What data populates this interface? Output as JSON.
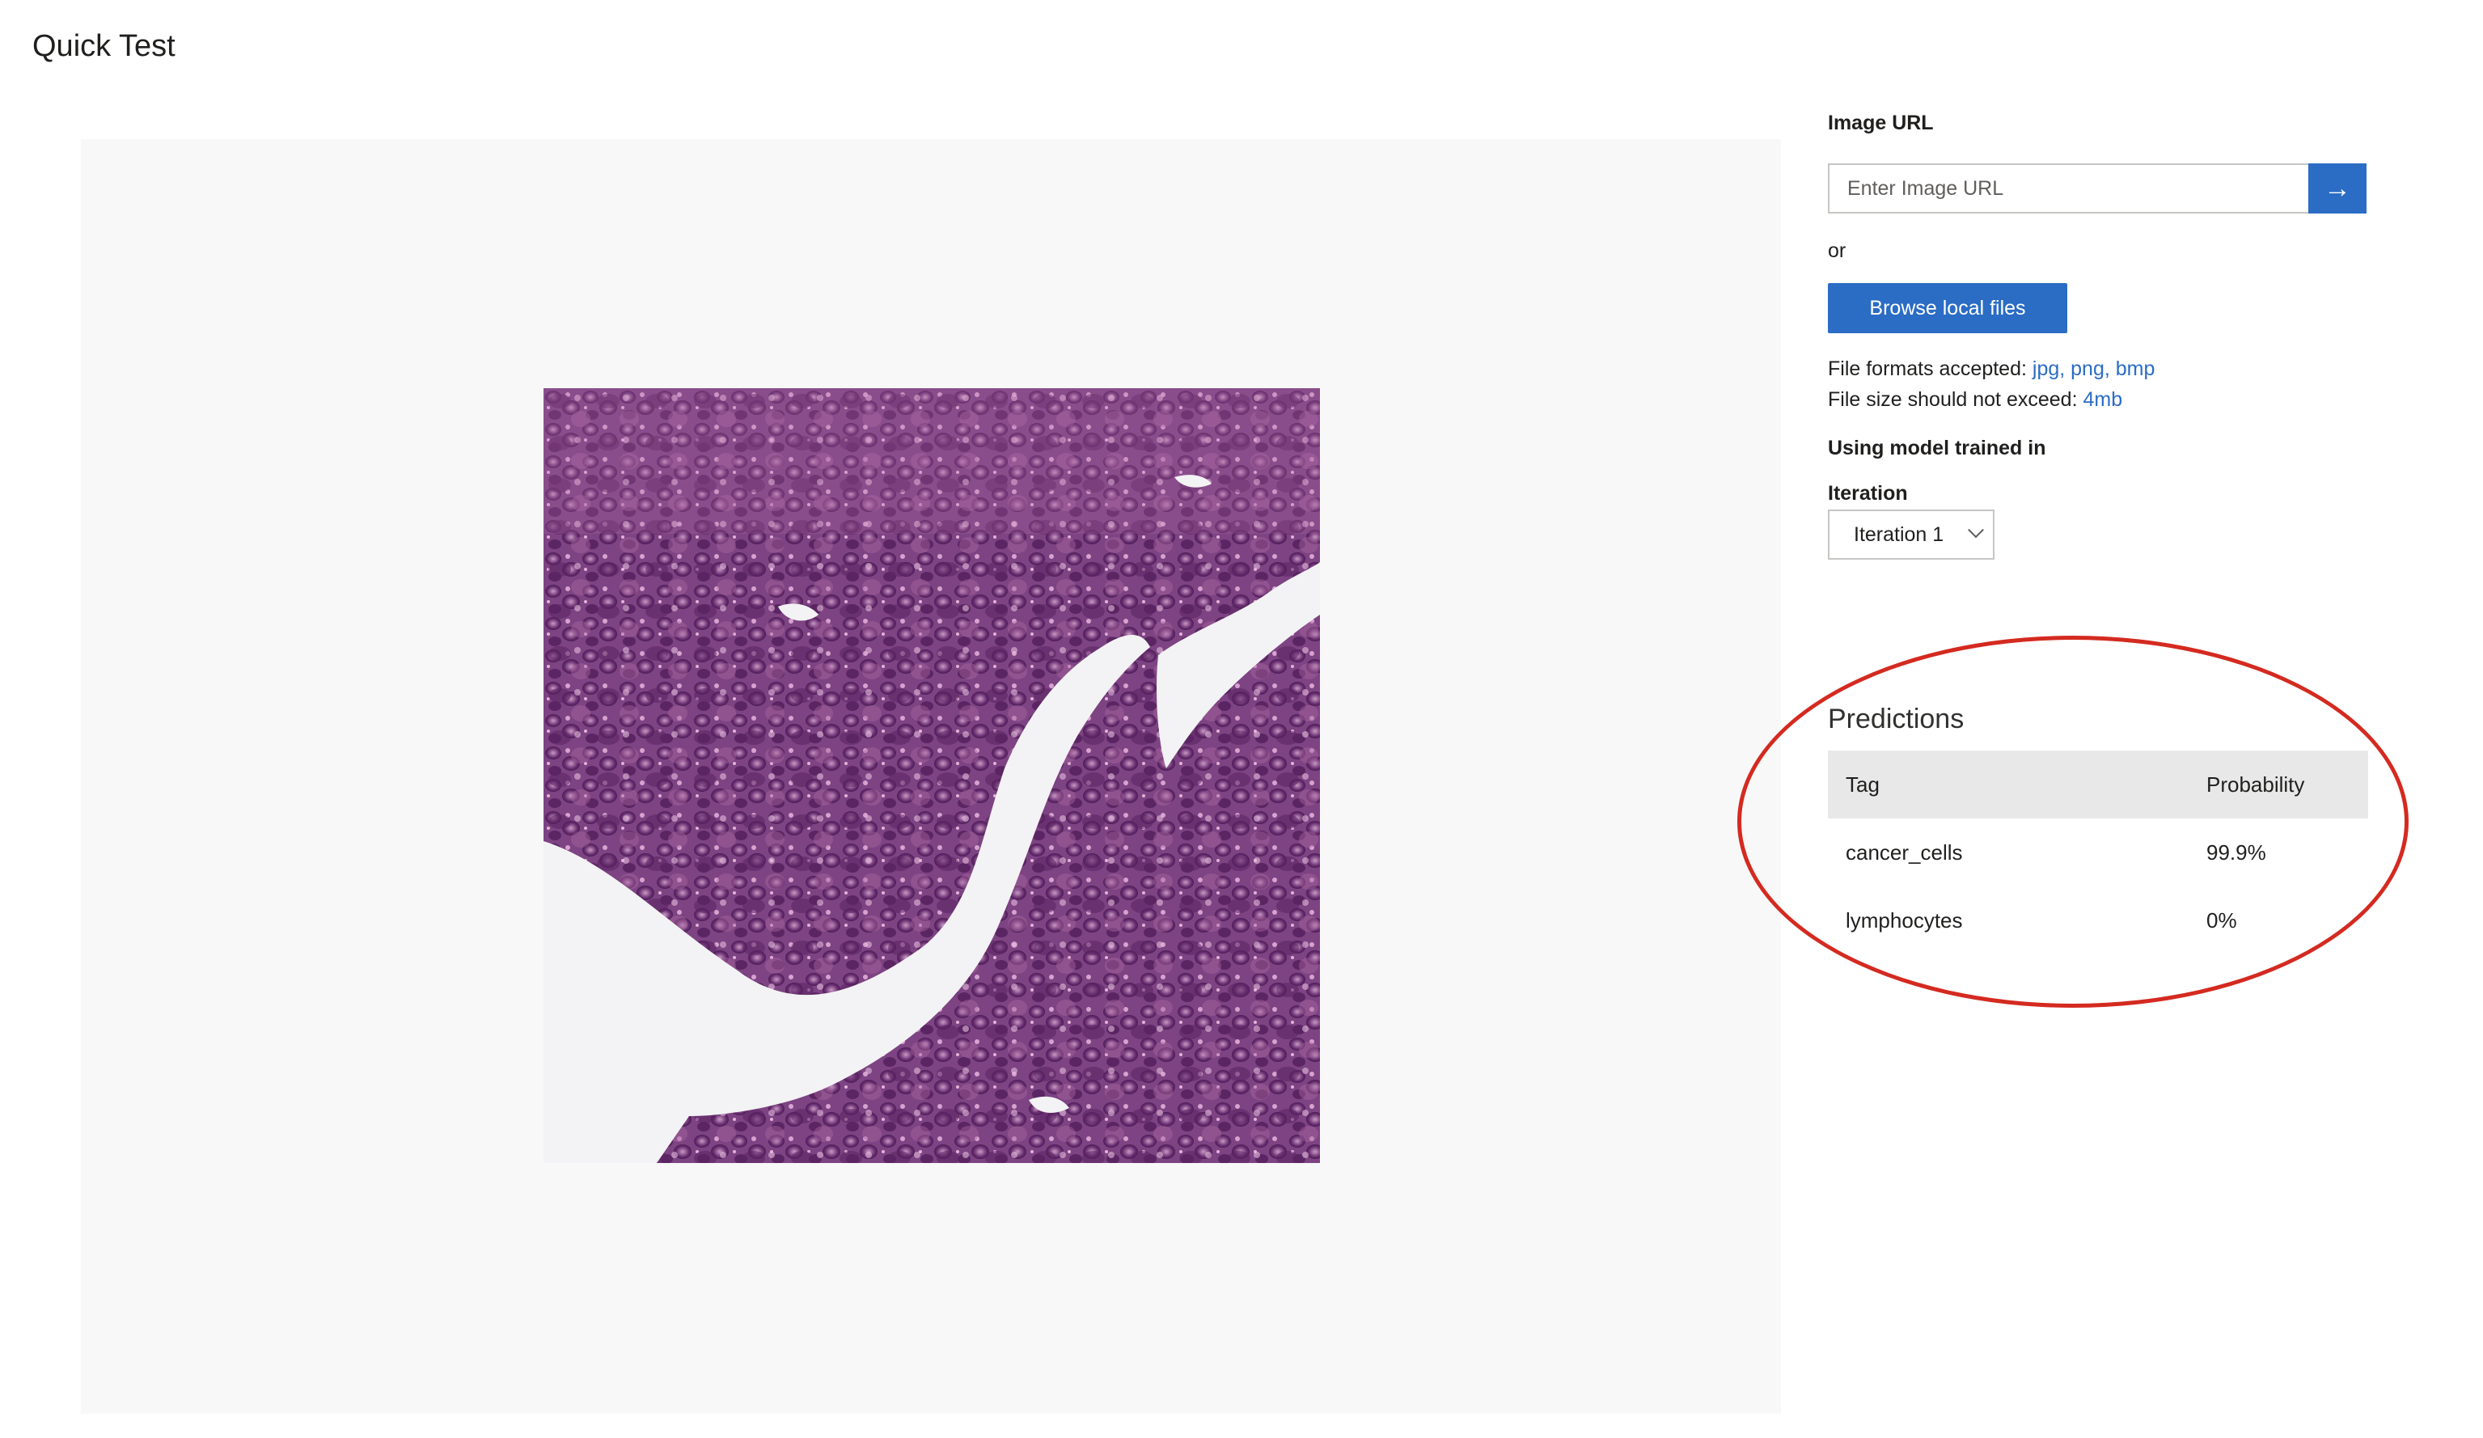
{
  "header": {
    "title": "Quick Test"
  },
  "side_panel": {
    "image_url_label": "Image URL",
    "image_url_placeholder": "Enter Image URL",
    "go_icon": "arrow-right-icon",
    "or_text": "or",
    "browse_label": "Browse local files",
    "formats_prefix": "File formats accepted: ",
    "formats_value": "jpg, png, bmp",
    "size_prefix": "File size should not exceed: ",
    "size_value": "4mb",
    "model_label": "Using model trained in",
    "iteration_label": "Iteration",
    "iteration_selected": "Iteration 1"
  },
  "predictions": {
    "title": "Predictions",
    "columns": [
      "Tag",
      "Probability"
    ],
    "rows": [
      {
        "tag": "cancer_cells",
        "probability": "99.9%"
      },
      {
        "tag": "lymphocytes",
        "probability": "0%"
      }
    ]
  },
  "colors": {
    "accent": "#2b6cc4",
    "highlight": "#d42a20",
    "tissue": "#7a3f7e"
  }
}
